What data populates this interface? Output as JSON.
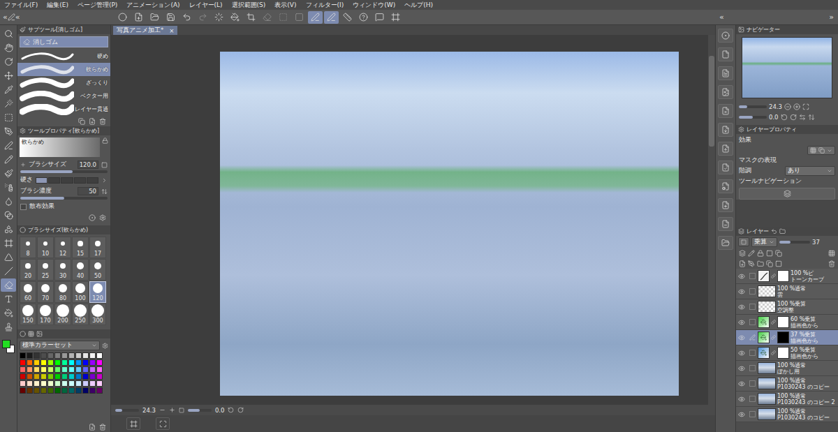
{
  "menu": [
    "ファイル(F)",
    "編集(E)",
    "ページ管理(P)",
    "アニメーション(A)",
    "レイヤー(L)",
    "選択範囲(S)",
    "表示(V)",
    "フィルター(I)",
    "ウィンドウ(W)",
    "ヘルプ(H)"
  ],
  "toolbar": {
    "collapse_left": "«",
    "collapse_right": "»",
    "buttons": [
      {
        "selected": false,
        "disabled": false
      },
      {
        "selected": false,
        "disabled": false
      },
      {
        "selected": false,
        "disabled": false
      },
      {
        "selected": false,
        "disabled": false
      },
      {
        "selected": false,
        "disabled": false
      },
      {
        "selected": false,
        "disabled": true
      },
      {
        "selected": false,
        "disabled": false
      },
      {
        "selected": false,
        "disabled": false
      },
      {
        "selected": false,
        "disabled": false
      },
      {
        "selected": false,
        "disabled": true
      },
      {
        "selected": false,
        "disabled": true
      },
      {
        "selected": false,
        "disabled": true
      },
      {
        "selected": true,
        "disabled": false
      },
      {
        "selected": true,
        "disabled": false
      },
      {
        "selected": false,
        "disabled": false
      },
      {
        "selected": false,
        "disabled": false
      },
      {
        "selected": false,
        "disabled": false
      },
      {
        "selected": false,
        "disabled": false
      }
    ]
  },
  "tools": [
    {
      "selected": false
    },
    {
      "selected": false
    },
    {
      "selected": false
    },
    {
      "selected": false
    },
    {
      "selected": false
    },
    {
      "selected": false
    },
    {
      "selected": false
    },
    {
      "selected": false
    },
    {
      "selected": false
    },
    {
      "selected": false
    },
    {
      "selected": false
    },
    {
      "selected": false
    },
    {
      "selected": false
    },
    {
      "selected": false
    },
    {
      "selected": false
    },
    {
      "selected": false
    },
    {
      "selected": false
    },
    {
      "selected": false
    },
    {
      "selected": true
    },
    {
      "selected": false
    },
    {
      "selected": false
    },
    {
      "selected": false
    }
  ],
  "colors": {
    "foreground": "#22dd22",
    "background": "#ffffff"
  },
  "subtool": {
    "title": "サブツール[消しゴム]",
    "group": "消しゴム",
    "brushes": [
      {
        "label": "硬め",
        "selected": false
      },
      {
        "label": "軟らかめ",
        "selected": true
      },
      {
        "label": "ざっくり",
        "selected": false
      },
      {
        "label": "ベクター用",
        "selected": false
      },
      {
        "label": "レイヤー貫通",
        "selected": false
      }
    ]
  },
  "tool_property": {
    "title": "ツールプロパティ[軟らかめ]",
    "preview": "軟らかめ",
    "brush_size": {
      "label": "ブラシサイズ",
      "value": "120.0",
      "level": 0.6
    },
    "hardness": {
      "label": "硬さ",
      "level": 0.2
    },
    "density": {
      "label": "ブラシ濃度",
      "value": "50",
      "level": 0.5
    },
    "scatter": {
      "label": "散布効果",
      "checked": false
    }
  },
  "brush_size_panel": {
    "title": "ブラシサイズ(軟らかめ)",
    "sizes": [
      {
        "label": "8",
        "selected": false
      },
      {
        "label": "10",
        "selected": false
      },
      {
        "label": "12",
        "selected": false
      },
      {
        "label": "15",
        "selected": false
      },
      {
        "label": "17",
        "selected": false
      },
      {
        "label": "20",
        "selected": false
      },
      {
        "label": "25",
        "selected": false
      },
      {
        "label": "30",
        "selected": false
      },
      {
        "label": "40",
        "selected": false
      },
      {
        "label": "50",
        "selected": false
      },
      {
        "label": "60",
        "selected": false
      },
      {
        "label": "70",
        "selected": false
      },
      {
        "label": "80",
        "selected": false
      },
      {
        "label": "100",
        "selected": false
      },
      {
        "label": "120",
        "selected": true
      },
      {
        "label": "150",
        "selected": false
      },
      {
        "label": "170",
        "selected": false
      },
      {
        "label": "200",
        "selected": false
      },
      {
        "label": "250",
        "selected": false
      },
      {
        "label": "300",
        "selected": false
      }
    ]
  },
  "color_set": {
    "title": "標準カラーセット",
    "swatches": [
      "#000000",
      "#1a1a1a",
      "#333333",
      "#4d4d4d",
      "#666666",
      "#808080",
      "#999999",
      "#b3b3b3",
      "#cccccc",
      "#e6e6e6",
      "#f2f2f2",
      "#ffffff",
      "#ff0000",
      "#ff6600",
      "#ffcc00",
      "#ffff00",
      "#99ff00",
      "#00ff00",
      "#00ff99",
      "#00ffff",
      "#0099ff",
      "#0000ff",
      "#9900ff",
      "#ff00ff",
      "#ff6666",
      "#ff9966",
      "#ffdd66",
      "#ffff66",
      "#ccff66",
      "#66ff66",
      "#66ffcc",
      "#66ffff",
      "#66ccff",
      "#6666ff",
      "#cc66ff",
      "#ff66ff",
      "#cc0000",
      "#cc5200",
      "#cca300",
      "#cccc00",
      "#7acc00",
      "#00cc00",
      "#00cc7a",
      "#00cccc",
      "#007acc",
      "#0000cc",
      "#7a00cc",
      "#cc00cc",
      "#ffcccc",
      "#ffe0cc",
      "#fff2cc",
      "#ffffcc",
      "#eeffcc",
      "#ccffcc",
      "#ccffee",
      "#ccffff",
      "#cceeff",
      "#ccccff",
      "#eeccff",
      "#ffccff",
      "#660000",
      "#663300",
      "#665200",
      "#666600",
      "#3d6600",
      "#006600",
      "#00663d",
      "#006666",
      "#003d66",
      "#000066",
      "#3d0066",
      "#660066"
    ]
  },
  "document": {
    "tab": "写真アニメ加工*",
    "close": "×",
    "zoom": "24.3",
    "zoom_level": 0.3,
    "angle": "0.0",
    "angle_level": 0.5
  },
  "navigator": {
    "title": "ナビゲーター",
    "zoom": "24.3",
    "zoom_level": 0.3,
    "angle": "0.0",
    "angle_level": 0.5
  },
  "layer_property": {
    "title": "レイヤープロパティ",
    "effect": "効果",
    "mask": "マスクの表現",
    "gradation": "階調",
    "gradation_value": "あり",
    "tool_navigation": "ツールナビゲーション"
  },
  "layers_panel": {
    "title": "レイヤー",
    "blend": "乗算",
    "opacity": "37",
    "opacity_level": 0.37,
    "layers": [
      {
        "mode": "100 %ピ",
        "name": "トーンカーブ",
        "kind": "correction",
        "mask": "white",
        "selected": false,
        "visible": true
      },
      {
        "mode": "100 %通常",
        "name": "雲",
        "kind": "transparent",
        "mask": "none",
        "selected": false,
        "visible": true
      },
      {
        "mode": "100 %乗算",
        "name": "空調整",
        "kind": "transparent",
        "mask": "none",
        "selected": false,
        "visible": true
      },
      {
        "mode": "60 %乗算",
        "name": "描画色から",
        "kind": "fill",
        "mask": "white",
        "color": "#3fcf3f",
        "selected": false,
        "visible": true
      },
      {
        "mode": "37 %乗算",
        "name": "描画色から",
        "kind": "fill",
        "mask": "black",
        "color": "#3fcf3f",
        "selected": true,
        "visible": true
      },
      {
        "mode": "50 %乗算",
        "name": "描画色から",
        "kind": "fill",
        "mask": "white",
        "color": "#4a90d8",
        "selected": false,
        "visible": true
      },
      {
        "mode": "100 %通常",
        "name": "ぼかし用",
        "kind": "photo",
        "mask": "none",
        "selected": false,
        "visible": true
      },
      {
        "mode": "100 %通常",
        "name": "P1030243 のコピー",
        "kind": "photo",
        "mask": "none",
        "selected": false,
        "visible": true
      },
      {
        "mode": "100 %通常",
        "name": "P1030243 のコピー 2",
        "kind": "photo",
        "mask": "none",
        "selected": false,
        "visible": true
      },
      {
        "mode": "100 %通常",
        "name": "P1030243 のコピー",
        "kind": "photo",
        "mask": "none",
        "selected": false,
        "visible": true
      }
    ]
  }
}
